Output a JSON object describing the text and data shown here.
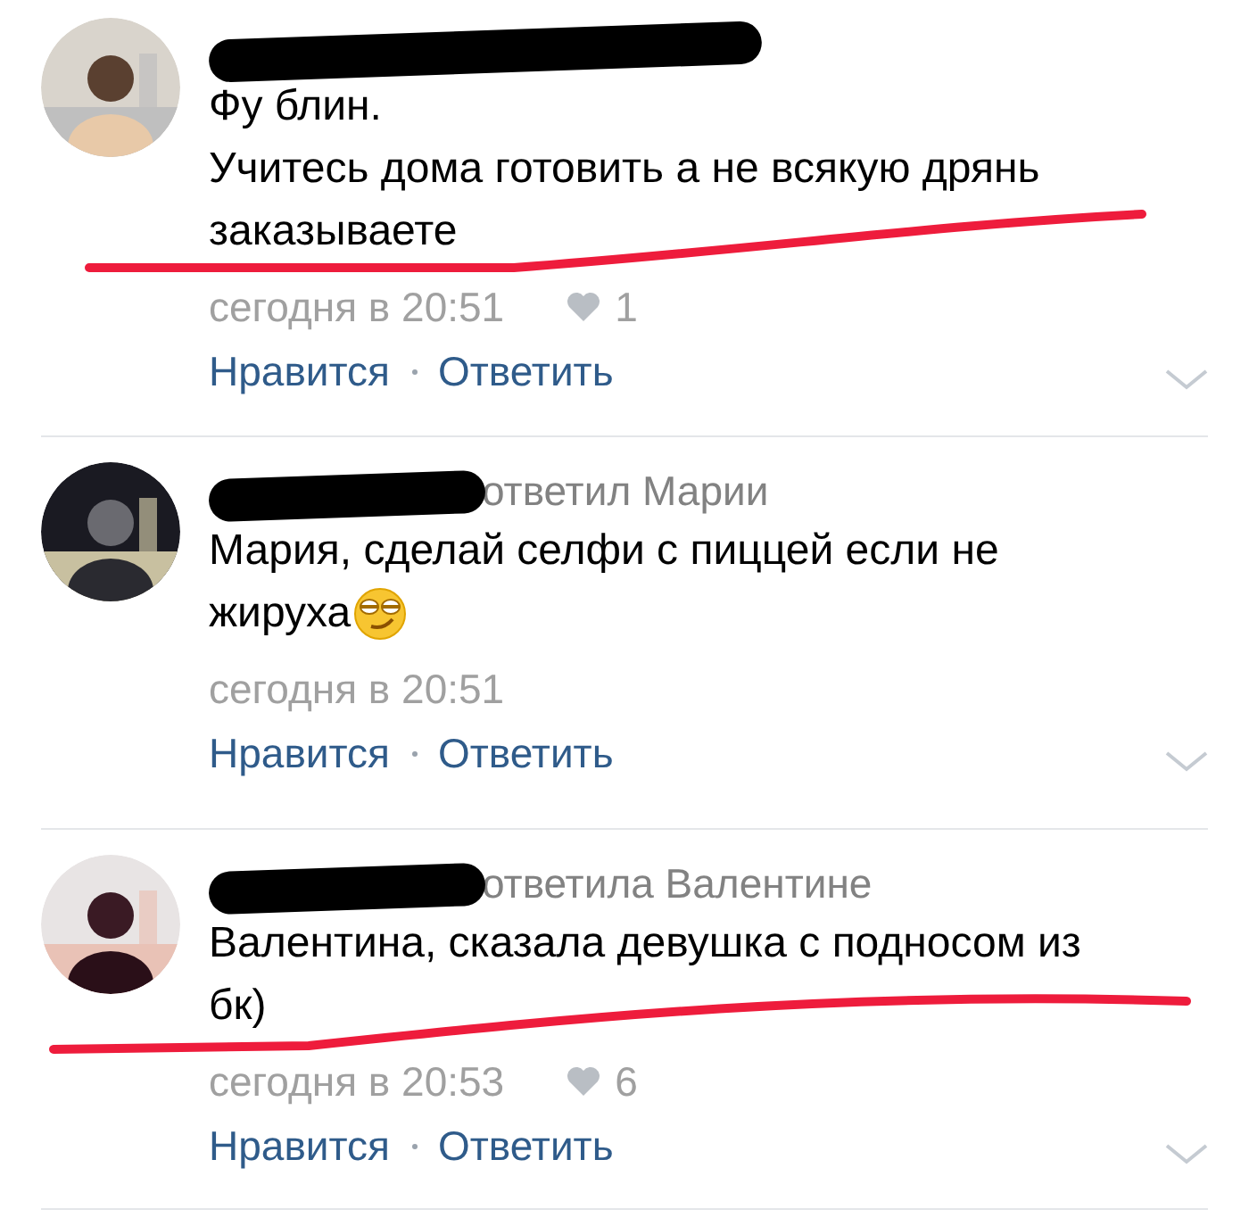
{
  "comments": [
    {
      "avatar": {
        "kind": "picture"
      },
      "redacted": true,
      "body": [
        "Фу блин.",
        "Учитесь дома готовить а не всякую дрянь",
        "заказываете"
      ],
      "time": "сегодня в 20:51",
      "likes": "1",
      "actions": [
        "Нравится",
        "Ответить"
      ],
      "underlined": true
    },
    {
      "avatar": {
        "kind": "picture"
      },
      "redacted": true,
      "reply_to": "ответил Марии",
      "body": [
        "Мария, сделай селфи с пиццей если не",
        "жируха"
      ],
      "emoji": true,
      "time": "сегодня в 20:51",
      "actions": [
        "Нравится",
        "Ответить"
      ]
    },
    {
      "avatar": {
        "kind": "picture"
      },
      "redacted": true,
      "reply_to": "ответила Валентине",
      "body": [
        "Валентина, сказала девушка с подносом из",
        "бк)"
      ],
      "time": "сегодня в 20:53",
      "likes": "6",
      "actions": [
        "Нравится",
        "Ответить"
      ],
      "underlined": true
    }
  ]
}
